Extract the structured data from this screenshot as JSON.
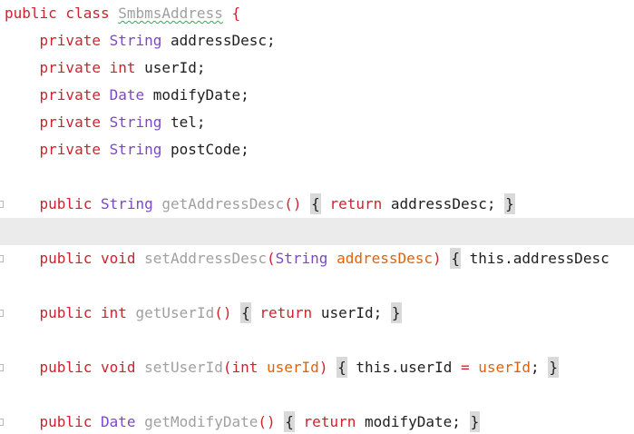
{
  "editor": {
    "lines": [
      {
        "text_parts": [
          {
            "t": "public class ",
            "c": "kw"
          },
          {
            "t": "SmbmsAddress",
            "c": "squiggle"
          },
          {
            "t": " {",
            "c": "kw"
          }
        ]
      },
      {
        "text_parts": [
          {
            "t": "    private ",
            "c": "kw"
          },
          {
            "t": "String",
            "c": "type"
          },
          {
            "t": " addressDesc;",
            "c": "plain"
          }
        ]
      },
      {
        "text_parts": [
          {
            "t": "    private ",
            "c": "kw"
          },
          {
            "t": "int",
            "c": "kw"
          },
          {
            "t": " userId;",
            "c": "plain"
          }
        ]
      },
      {
        "text_parts": [
          {
            "t": "    private ",
            "c": "kw"
          },
          {
            "t": "Date",
            "c": "type"
          },
          {
            "t": " modifyDate;",
            "c": "plain"
          }
        ]
      },
      {
        "text_parts": [
          {
            "t": "    private ",
            "c": "kw"
          },
          {
            "t": "String",
            "c": "type"
          },
          {
            "t": " tel;",
            "c": "plain"
          }
        ]
      },
      {
        "text_parts": [
          {
            "t": "    private ",
            "c": "kw"
          },
          {
            "t": "String",
            "c": "type"
          },
          {
            "t": " postCode;",
            "c": "plain"
          }
        ]
      },
      {
        "text_parts": []
      },
      {
        "text_parts": [
          {
            "t": "    public ",
            "c": "kw"
          },
          {
            "t": "String",
            "c": "type"
          },
          {
            "t": " getAddressDesc",
            "c": "method"
          },
          {
            "t": "()",
            "c": "kw"
          },
          {
            "t": " ",
            "c": "plain"
          },
          {
            "t": "{",
            "c": "brace-hl"
          },
          {
            "t": " ",
            "c": "plain"
          },
          {
            "t": "return",
            "c": "kw"
          },
          {
            "t": " addressDesc;",
            "c": "plain"
          },
          {
            "t": " ",
            "c": "plain"
          },
          {
            "t": "}",
            "c": "brace-hl"
          }
        ],
        "gutter": true
      },
      {
        "text_parts": [],
        "current": true
      },
      {
        "text_parts": [
          {
            "t": "    public ",
            "c": "kw"
          },
          {
            "t": "void",
            "c": "kw"
          },
          {
            "t": " setAddressDesc",
            "c": "method"
          },
          {
            "t": "(",
            "c": "kw"
          },
          {
            "t": "String",
            "c": "type"
          },
          {
            "t": " addressDesc",
            "c": "param"
          },
          {
            "t": ")",
            "c": "kw"
          },
          {
            "t": " ",
            "c": "plain"
          },
          {
            "t": "{",
            "c": "brace-hl"
          },
          {
            "t": " this.addressDesc",
            "c": "field"
          }
        ],
        "gutter": true
      },
      {
        "text_parts": []
      },
      {
        "text_parts": [
          {
            "t": "    public ",
            "c": "kw"
          },
          {
            "t": "int",
            "c": "kw"
          },
          {
            "t": " getUserId",
            "c": "method"
          },
          {
            "t": "()",
            "c": "kw"
          },
          {
            "t": " ",
            "c": "plain"
          },
          {
            "t": "{",
            "c": "brace-hl"
          },
          {
            "t": " ",
            "c": "plain"
          },
          {
            "t": "return",
            "c": "kw"
          },
          {
            "t": " userId;",
            "c": "plain"
          },
          {
            "t": " ",
            "c": "plain"
          },
          {
            "t": "}",
            "c": "brace-hl"
          }
        ],
        "gutter": true
      },
      {
        "text_parts": []
      },
      {
        "text_parts": [
          {
            "t": "    public ",
            "c": "kw"
          },
          {
            "t": "void",
            "c": "kw"
          },
          {
            "t": " setUserId",
            "c": "method"
          },
          {
            "t": "(",
            "c": "kw"
          },
          {
            "t": "int",
            "c": "kw"
          },
          {
            "t": " userId",
            "c": "param"
          },
          {
            "t": ")",
            "c": "kw"
          },
          {
            "t": " ",
            "c": "plain"
          },
          {
            "t": "{",
            "c": "brace-hl"
          },
          {
            "t": " this.userId",
            "c": "field"
          },
          {
            "t": " = ",
            "c": "kw"
          },
          {
            "t": "userId",
            "c": "param"
          },
          {
            "t": ";",
            "c": "plain"
          },
          {
            "t": " ",
            "c": "plain"
          },
          {
            "t": "}",
            "c": "brace-hl"
          }
        ],
        "gutter": true
      },
      {
        "text_parts": []
      },
      {
        "text_parts": [
          {
            "t": "    public ",
            "c": "kw"
          },
          {
            "t": "Date",
            "c": "type"
          },
          {
            "t": " getModifyDate",
            "c": "method"
          },
          {
            "t": "()",
            "c": "kw"
          },
          {
            "t": " ",
            "c": "plain"
          },
          {
            "t": "{",
            "c": "brace-hl"
          },
          {
            "t": " ",
            "c": "plain"
          },
          {
            "t": "return",
            "c": "kw"
          },
          {
            "t": " modifyDate;",
            "c": "plain"
          },
          {
            "t": " ",
            "c": "plain"
          },
          {
            "t": "}",
            "c": "brace-hl"
          }
        ],
        "gutter": true
      }
    ]
  }
}
